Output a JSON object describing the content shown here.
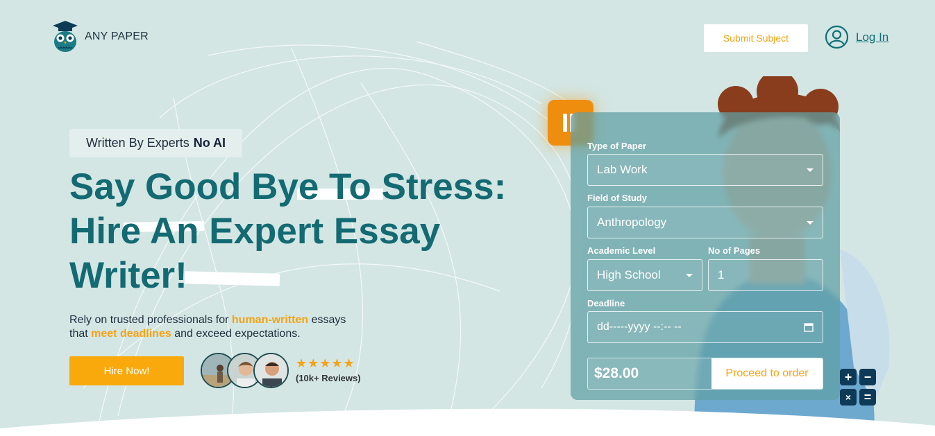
{
  "brand": {
    "name": "ANY PAPER",
    "icon": "owl-graduate-icon"
  },
  "header": {
    "submit_label": "Submit Subject",
    "login_label": "Log In",
    "login_icon": "user-circle-icon"
  },
  "hero": {
    "badge_text": "Written By Experts",
    "badge_bold": "No AI",
    "headline": [
      "Say Good Bye To Stress:",
      "Hire An Expert Essay",
      "Writer!"
    ],
    "desc_1": "Rely on trusted professionals for",
    "desc_hl_1": "human-written",
    "desc_2": "essays",
    "desc_3": "that",
    "desc_hl_2": "meet deadlines",
    "desc_4": "and exceed expectations.",
    "hire_label": "Hire Now!",
    "stars": "★★★★★",
    "rating_fraction": 1.0,
    "reviews": "(10k+ Reviews)"
  },
  "form": {
    "type_label": "Type of Paper",
    "type_value": "Lab Work",
    "field_label": "Field of Study",
    "field_value": "Anthropology",
    "level_label": "Academic Level",
    "level_value": "High School",
    "pages_label": "No of Pages",
    "pages_value": "1",
    "deadline_label": "Deadline",
    "deadline_value": "dd-----yyyy --:-- --",
    "price": "$28.00",
    "proceed_label": "Proceed to order"
  },
  "calculator": {
    "keys": [
      "+",
      "−",
      "×",
      "="
    ]
  },
  "colors": {
    "accent": "#f5a312",
    "teal": "#136a72",
    "background": "#d3e6e4"
  }
}
